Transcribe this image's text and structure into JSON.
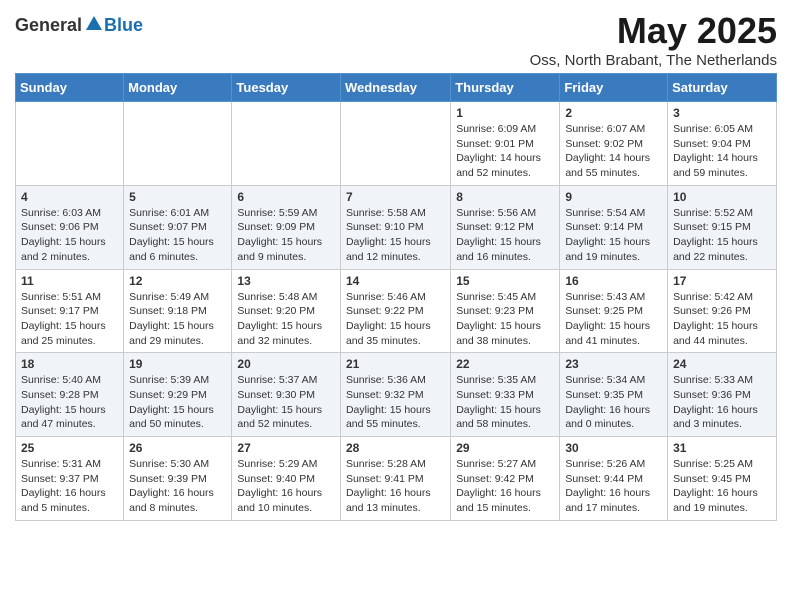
{
  "logo": {
    "general": "General",
    "blue": "Blue"
  },
  "title": "May 2025",
  "location": "Oss, North Brabant, The Netherlands",
  "days_header": [
    "Sunday",
    "Monday",
    "Tuesday",
    "Wednesday",
    "Thursday",
    "Friday",
    "Saturday"
  ],
  "weeks": [
    [
      {
        "day": "",
        "info": ""
      },
      {
        "day": "",
        "info": ""
      },
      {
        "day": "",
        "info": ""
      },
      {
        "day": "",
        "info": ""
      },
      {
        "day": "1",
        "info": "Sunrise: 6:09 AM\nSunset: 9:01 PM\nDaylight: 14 hours\nand 52 minutes."
      },
      {
        "day": "2",
        "info": "Sunrise: 6:07 AM\nSunset: 9:02 PM\nDaylight: 14 hours\nand 55 minutes."
      },
      {
        "day": "3",
        "info": "Sunrise: 6:05 AM\nSunset: 9:04 PM\nDaylight: 14 hours\nand 59 minutes."
      }
    ],
    [
      {
        "day": "4",
        "info": "Sunrise: 6:03 AM\nSunset: 9:06 PM\nDaylight: 15 hours\nand 2 minutes."
      },
      {
        "day": "5",
        "info": "Sunrise: 6:01 AM\nSunset: 9:07 PM\nDaylight: 15 hours\nand 6 minutes."
      },
      {
        "day": "6",
        "info": "Sunrise: 5:59 AM\nSunset: 9:09 PM\nDaylight: 15 hours\nand 9 minutes."
      },
      {
        "day": "7",
        "info": "Sunrise: 5:58 AM\nSunset: 9:10 PM\nDaylight: 15 hours\nand 12 minutes."
      },
      {
        "day": "8",
        "info": "Sunrise: 5:56 AM\nSunset: 9:12 PM\nDaylight: 15 hours\nand 16 minutes."
      },
      {
        "day": "9",
        "info": "Sunrise: 5:54 AM\nSunset: 9:14 PM\nDaylight: 15 hours\nand 19 minutes."
      },
      {
        "day": "10",
        "info": "Sunrise: 5:52 AM\nSunset: 9:15 PM\nDaylight: 15 hours\nand 22 minutes."
      }
    ],
    [
      {
        "day": "11",
        "info": "Sunrise: 5:51 AM\nSunset: 9:17 PM\nDaylight: 15 hours\nand 25 minutes."
      },
      {
        "day": "12",
        "info": "Sunrise: 5:49 AM\nSunset: 9:18 PM\nDaylight: 15 hours\nand 29 minutes."
      },
      {
        "day": "13",
        "info": "Sunrise: 5:48 AM\nSunset: 9:20 PM\nDaylight: 15 hours\nand 32 minutes."
      },
      {
        "day": "14",
        "info": "Sunrise: 5:46 AM\nSunset: 9:22 PM\nDaylight: 15 hours\nand 35 minutes."
      },
      {
        "day": "15",
        "info": "Sunrise: 5:45 AM\nSunset: 9:23 PM\nDaylight: 15 hours\nand 38 minutes."
      },
      {
        "day": "16",
        "info": "Sunrise: 5:43 AM\nSunset: 9:25 PM\nDaylight: 15 hours\nand 41 minutes."
      },
      {
        "day": "17",
        "info": "Sunrise: 5:42 AM\nSunset: 9:26 PM\nDaylight: 15 hours\nand 44 minutes."
      }
    ],
    [
      {
        "day": "18",
        "info": "Sunrise: 5:40 AM\nSunset: 9:28 PM\nDaylight: 15 hours\nand 47 minutes."
      },
      {
        "day": "19",
        "info": "Sunrise: 5:39 AM\nSunset: 9:29 PM\nDaylight: 15 hours\nand 50 minutes."
      },
      {
        "day": "20",
        "info": "Sunrise: 5:37 AM\nSunset: 9:30 PM\nDaylight: 15 hours\nand 52 minutes."
      },
      {
        "day": "21",
        "info": "Sunrise: 5:36 AM\nSunset: 9:32 PM\nDaylight: 15 hours\nand 55 minutes."
      },
      {
        "day": "22",
        "info": "Sunrise: 5:35 AM\nSunset: 9:33 PM\nDaylight: 15 hours\nand 58 minutes."
      },
      {
        "day": "23",
        "info": "Sunrise: 5:34 AM\nSunset: 9:35 PM\nDaylight: 16 hours\nand 0 minutes."
      },
      {
        "day": "24",
        "info": "Sunrise: 5:33 AM\nSunset: 9:36 PM\nDaylight: 16 hours\nand 3 minutes."
      }
    ],
    [
      {
        "day": "25",
        "info": "Sunrise: 5:31 AM\nSunset: 9:37 PM\nDaylight: 16 hours\nand 5 minutes."
      },
      {
        "day": "26",
        "info": "Sunrise: 5:30 AM\nSunset: 9:39 PM\nDaylight: 16 hours\nand 8 minutes."
      },
      {
        "day": "27",
        "info": "Sunrise: 5:29 AM\nSunset: 9:40 PM\nDaylight: 16 hours\nand 10 minutes."
      },
      {
        "day": "28",
        "info": "Sunrise: 5:28 AM\nSunset: 9:41 PM\nDaylight: 16 hours\nand 13 minutes."
      },
      {
        "day": "29",
        "info": "Sunrise: 5:27 AM\nSunset: 9:42 PM\nDaylight: 16 hours\nand 15 minutes."
      },
      {
        "day": "30",
        "info": "Sunrise: 5:26 AM\nSunset: 9:44 PM\nDaylight: 16 hours\nand 17 minutes."
      },
      {
        "day": "31",
        "info": "Sunrise: 5:25 AM\nSunset: 9:45 PM\nDaylight: 16 hours\nand 19 minutes."
      }
    ]
  ]
}
